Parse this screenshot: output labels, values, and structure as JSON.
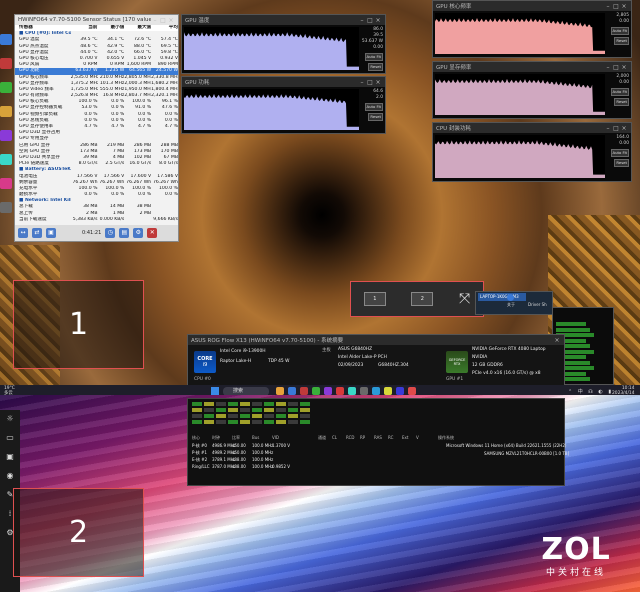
{
  "hwinfo": {
    "title": "HWiNFO64 v7.70-5100 Sensor Status [170 values hidden]",
    "header": [
      "传感器",
      "当前",
      "最小值",
      "最大值",
      "平均"
    ],
    "rows": [
      {
        "n": "■ CPU [#0]: Intel Core i9-13900K: 增强型",
        "c": "",
        "mi": "",
        "ma": "",
        "a": "",
        "k": "sect"
      },
      {
        "n": "GPU 温度",
        "c": "39.5 °C",
        "mi": "34.1 °C",
        "ma": "72.6 °C",
        "a": "57.4 °C"
      },
      {
        "n": "GPU 热点温度",
        "c": "48.6 °C",
        "mi": "42.9 °C",
        "ma": "88.0 °C",
        "a": "69.5 °C"
      },
      {
        "n": "GPU 显存温度",
        "c": "44.0 °C",
        "mi": "42.0 °C",
        "ma": "66.0 °C",
        "a": "59.8 °C"
      },
      {
        "n": "GPU 核心电压",
        "c": "0.700 V",
        "mi": "0.655 V",
        "ma": "1.045 V",
        "a": "0.932 V"
      },
      {
        "n": "GPU 风扇",
        "c": "0 RPM",
        "mi": "0 RPM",
        "ma": "1,600 RPM",
        "a": "890 RPM"
      },
      {
        "n": "GPU 功耗",
        "c": "63.637 W",
        "mi": "1.235 W",
        "ma": "64.565 W",
        "a": "24.570 W",
        "k": "sel"
      },
      {
        "n": "GPU 核心频率",
        "c": "2,535.0 MHz",
        "mi": "210.0 MHz",
        "ma": "2,805.0 MHz",
        "a": "2,330.8 MHz"
      },
      {
        "n": "GPU 显存频率",
        "c": "1,375.2 MHz",
        "mi": "101.3 MHz",
        "ma": "2,000.3 MHz",
        "a": "1,680.2 MHz"
      },
      {
        "n": "GPU Video 频率",
        "c": "1,725.0 MHz",
        "mi": "555.0 MHz",
        "ma": "1,950.0 MHz",
        "a": "1,800.4 MHz"
      },
      {
        "n": "GPU 有效频率",
        "c": "2,526.8 MHz",
        "mi": "16.8 MHz",
        "ma": "2,803.7 MHz",
        "a": "2,320.1 MHz"
      },
      {
        "n": "GPU 核心负载",
        "c": "100.0 %",
        "mi": "0.0 %",
        "ma": "100.0 %",
        "a": "96.1 %"
      },
      {
        "n": "GPU 显存控制器负载",
        "c": "53.0 %",
        "mi": "0.0 %",
        "ma": "91.0 %",
        "a": "47.6 %"
      },
      {
        "n": "GPU 视频引擎负载",
        "c": "0.0 %",
        "mi": "0.0 %",
        "ma": "0.0 %",
        "a": "0.0 %"
      },
      {
        "n": "GPU 总线负载",
        "c": "0.0 %",
        "mi": "0.0 %",
        "ma": "0.0 %",
        "a": "0.0 %"
      },
      {
        "n": "GPU 显存使用率",
        "c": "4.7 %",
        "mi": "4.7 %",
        "ma": "4.7 %",
        "a": "4.7 %"
      },
      {
        "n": "GPU D3D 显存占用",
        "c": "",
        "mi": "",
        "ma": "",
        "a": ""
      },
      {
        "n": "GPU 专用显存",
        "c": "",
        "mi": "",
        "ma": "",
        "a": ""
      },
      {
        "n": "已用 GPU 显存",
        "c": "286 MB",
        "mi": "219 MB",
        "ma": "286 MB",
        "a": "288 MB"
      },
      {
        "n": "空闲 GPU 显存",
        "c": "173 MB",
        "mi": "7 MB",
        "ma": "173 MB",
        "a": "170 MB"
      },
      {
        "n": "GPU D3D 共享显存",
        "c": "39 MB",
        "mi": "4 MB",
        "ma": "102 MB",
        "a": "67 MB"
      },
      {
        "n": "PCIe 链路速度",
        "c": "8.0 GT/s",
        "mi": "2.5 GT/s",
        "ma": "16.0 GT/s",
        "a": "8.0 GT/s"
      },
      {
        "n": "■ Battery: ASUSTeK ASUS Battery",
        "c": "",
        "mi": "",
        "ma": "",
        "a": "",
        "k": "sect"
      },
      {
        "n": "电池电压",
        "c": "17.566 V",
        "mi": "17.566 V",
        "ma": "17.600 V",
        "a": "17.586 V"
      },
      {
        "n": "剩余容量",
        "c": "76.267 Wh",
        "mi": "76.267 Wh",
        "ma": "76.267 Wh",
        "a": "76.267 Wh"
      },
      {
        "n": "充电水平",
        "c": "100.0 %",
        "mi": "100.0 %",
        "ma": "100.0 %",
        "a": "100.0 %"
      },
      {
        "n": "磨损水平",
        "c": "0.0 %",
        "mi": "0.0 %",
        "ma": "0.0 %",
        "a": "0.0 %"
      },
      {
        "n": "■ Network: Intel Killer Wi-Fi 6E",
        "c": "",
        "mi": "",
        "ma": "",
        "a": "",
        "k": "sect"
      },
      {
        "n": "总下载",
        "c": "38 MB",
        "mi": "14 MB",
        "ma": "38 MB",
        "a": ""
      },
      {
        "n": "总上传",
        "c": "2 MB",
        "mi": "1 MB",
        "ma": "2 MB",
        "a": ""
      },
      {
        "n": "当前下载速度",
        "c": "5,383 KB/s",
        "mi": "0.000 KB/s",
        "ma": "",
        "a": "9,666 KB/s"
      }
    ],
    "clock": "0:41:21"
  },
  "graphs": [
    {
      "title": "GPU 温度",
      "vals": [
        "86.0",
        "39.5",
        "53.637 W",
        "0.00"
      ],
      "auto": "Auto Fit",
      "reset": "Reset"
    },
    {
      "title": "GPU 功耗",
      "vals": [
        "64.6",
        "2.0",
        "",
        ""
      ],
      "auto": "Auto Fit",
      "reset": "Reset"
    },
    {
      "title": "GPU 核心频率",
      "vals": [
        "2,805",
        "0.00",
        "",
        ""
      ],
      "auto": "Auto Fit",
      "reset": "Reset"
    },
    {
      "title": "GPU 显存频率",
      "vals": [
        "2,000",
        "0.00",
        "",
        ""
      ],
      "auto": "Auto Fit",
      "reset": "Reset"
    },
    {
      "title": "CPU 封装功耗",
      "vals": [
        "164.0",
        "0.00",
        "",
        ""
      ],
      "auto": "Auto Fit",
      "reset": "Reset"
    }
  ],
  "monitors": {
    "one": "1",
    "two": "2"
  },
  "snap": {
    "a": "1",
    "b": "2"
  },
  "sysinfo": {
    "title": "ASUS ROG Flow X13 (HWiNFO64 v7.70-5100) - 系统摘要",
    "cpu_model": "Intel Core i9-13900H",
    "cpu_sub": "Raptor Lake-H",
    "cpu_lbl": "CPU #0",
    "cpu_tdp": "TDP 45 W",
    "mb_title": "主板",
    "mb_model": "ASUS G6840HZ",
    "mb_chipset": "Intel Alder Lake-P PCH",
    "bios_date": "02/09/2023",
    "bios_ver": "G6840HZ.304",
    "gpu_model": "NVIDIA GeForce RTX 4080 Laptop",
    "gpu_brand": "NVIDIA",
    "gpu_mem": "12 GB GDDR6",
    "gpu_pcie": "PCIe v4.0 x16 (16.0 GT/s) @ x8",
    "gpu_lbl": "GPU #1",
    "os_title": "操作系统",
    "os": "Microsoft Windows 11 Home (x64) Build 22621.1555 (22H2)",
    "drive": "SAMSUNG MZVL21T0HCLR-00B00 [1.0 TB]",
    "core_caption": "CORE",
    "core_sub": "i9",
    "gpu_caption": "GEFORCE RTX",
    "cache_row": [
      "核心",
      "时钟",
      "比率",
      "Bus",
      "VID"
    ],
    "core_rows": [
      [
        "P-核 #0",
        "4986.9 MHz",
        "x50.00",
        "100.0 MHz",
        "1.3700 V"
      ],
      [
        "P-核 #1",
        "4989.2 MHz",
        "x50.00",
        "100.0 MHz",
        ""
      ],
      [
        "E-核 #2",
        "3789.1 MHz",
        "x38.00",
        "100.0 MHz",
        ""
      ],
      [
        "Ring/LLC",
        "3787.0 MHz",
        "x38.00",
        "100.0 MHz",
        "0.9852 V"
      ]
    ],
    "mem_header": [
      "通道",
      "CL",
      "RCD",
      "RP",
      "RAS",
      "RC",
      "Ext",
      "V"
    ]
  },
  "taskbar": {
    "weather_temp": "19°C",
    "weather_desc": "多云",
    "search": "搜索",
    "time": "10:14",
    "date": "2023/4/14",
    "tray": "⌃ 中 ☊ ◐ ▮"
  },
  "control": {
    "label_a": "关于",
    "label_b": "Driver Sh",
    "lens": "LAPTOP-1K0G2TM3"
  },
  "zol": {
    "main": "ZOL",
    "sub": "中关村在线"
  },
  "colors": {
    "accent_red": "#e05050",
    "graph_blue": "#b0b0f0",
    "graph_pink": "#f0a0a0",
    "graph_mauve": "#d0a8c0"
  }
}
